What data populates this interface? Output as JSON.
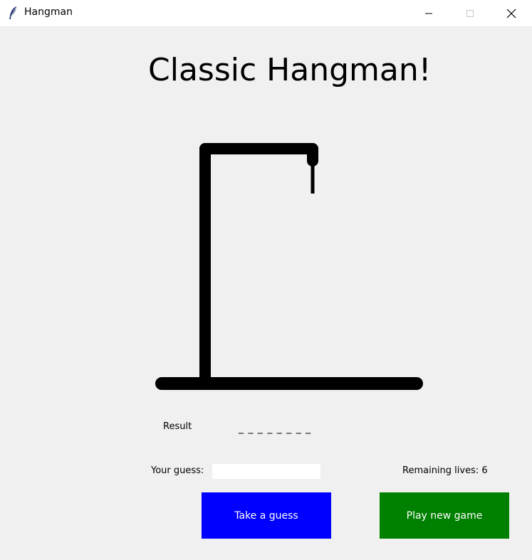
{
  "window": {
    "title": "Hangman",
    "icon": "feather-icon",
    "controls": [
      "minimize-icon",
      "maximize-icon",
      "close-icon"
    ]
  },
  "game": {
    "heading": "Classic Hangman!",
    "result_label": "Result",
    "word_display": "_ _ _ _ _ _ _ _",
    "guess_label": "Your guess:",
    "guess_value": "",
    "lives_text": "Remaining lives: 6",
    "lives_remaining": 6,
    "guess_button": "Take a guess",
    "new_game_button": "Play new game"
  },
  "colors": {
    "background": "#f0f0f0",
    "guess_button": "#0000ff",
    "new_game_button": "#008000",
    "button_text": "#ffffff",
    "gallows": "#000000"
  }
}
